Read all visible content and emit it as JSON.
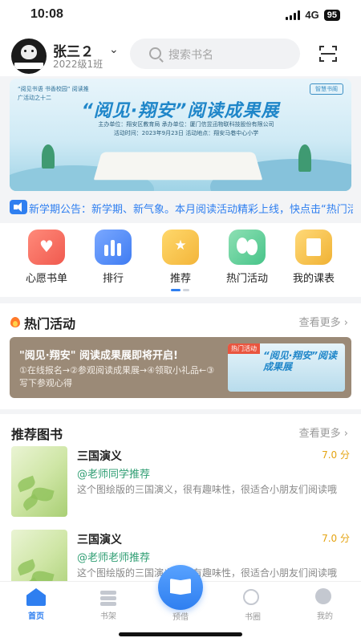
{
  "status_bar": {
    "time": "10:08",
    "network": "4G",
    "battery": "95"
  },
  "user": {
    "name": "张三２",
    "class": "2022级1班"
  },
  "search": {
    "placeholder": "搜索书名"
  },
  "banner": {
    "tag_text": "“阅见书语 书香校园” 阅读推广活动之十二",
    "logo_text": "智慧书阁",
    "title": "“阅见·翔安”阅读成果展",
    "meta_line1": "主办单位：翔安区教育局   承办单位：厦门信昱迅物联科技股份有限公司",
    "meta_line2": "活动时间：2023年9月23日   活动地点：翔安马巷中心小学"
  },
  "announcement": {
    "text": "新学期公告：新学期、新气象。本月阅读活动精彩上线，快点击“热门活动”"
  },
  "quick_nav": [
    {
      "label": "心愿书单",
      "icon": "heart-icon"
    },
    {
      "label": "排行",
      "icon": "ranking-icon"
    },
    {
      "label": "推荐",
      "icon": "star-icon"
    },
    {
      "label": "热门活动",
      "icon": "balloon-icon"
    },
    {
      "label": "我的课表",
      "icon": "schedule-icon"
    }
  ],
  "hot_activity": {
    "title": "热门活动",
    "more": "查看更多",
    "card_title": "\"阅见·翔安\" 阅读成果展即将开启!",
    "card_desc": "①在线报名→②参观阅读成果展→④领取小礼品←③写下参观心得",
    "image_tag": "热门活动",
    "image_title": "“阅见·翔安”阅读成果展"
  },
  "recommended": {
    "title": "推荐图书",
    "more": "查看更多",
    "books": [
      {
        "name": "三国演义",
        "score": "7.0 分",
        "recommender": "@老师同学推荐",
        "desc": "这个图绘版的三国演义，很有趣味性，很适合小朋友们阅读哦"
      },
      {
        "name": "三国演义",
        "score": "7.0 分",
        "recommender": "@老师老师推荐",
        "desc": "这个图绘版的三国演义，很有趣味性，很适合小朋友们阅读哦"
      }
    ]
  },
  "tabbar": {
    "home": "首页",
    "shelf": "书架",
    "borrow": "预借",
    "circle": "书圈",
    "me": "我的"
  },
  "colors": {
    "accent": "#2f7ff0",
    "score": "#e4a412",
    "recommender": "#2f9e73"
  }
}
